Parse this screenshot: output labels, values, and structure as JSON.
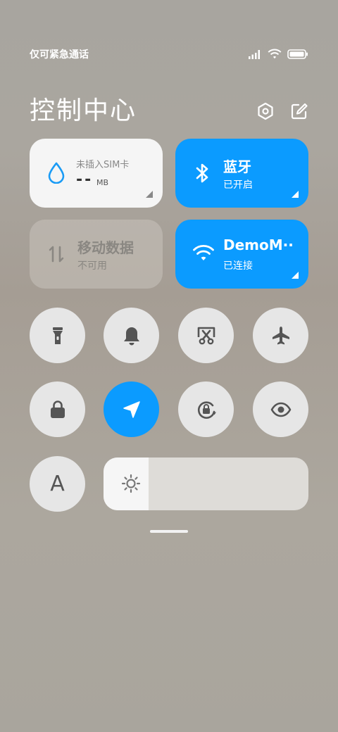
{
  "status_bar": {
    "carrier_text": "仅可紧急通话"
  },
  "header": {
    "title": "控制中心"
  },
  "tiles": {
    "data_usage": {
      "label": "未插入SIM卡",
      "value": "--",
      "unit": "MB"
    },
    "bluetooth": {
      "label": "蓝牙",
      "status": "已开启"
    },
    "mobile_data": {
      "label": "移动数据",
      "status": "不可用"
    },
    "wifi": {
      "label": "DemoM··",
      "status": "已连接"
    }
  },
  "toggles": [
    {
      "name": "flashlight-icon",
      "active": false
    },
    {
      "name": "bell-icon",
      "active": false
    },
    {
      "name": "screenshot-icon",
      "active": false
    },
    {
      "name": "airplane-icon",
      "active": false
    },
    {
      "name": "lock-icon",
      "active": false
    },
    {
      "name": "location-icon",
      "active": true
    },
    {
      "name": "rotation-lock-icon",
      "active": false
    },
    {
      "name": "eye-icon",
      "active": false
    }
  ],
  "font_button": {
    "label": "A"
  },
  "brightness": {
    "level": 0.22
  },
  "colors": {
    "accent": "#0b9bff",
    "tile_white": "#f5f5f5",
    "toggle_bg": "#e6e6e6"
  }
}
